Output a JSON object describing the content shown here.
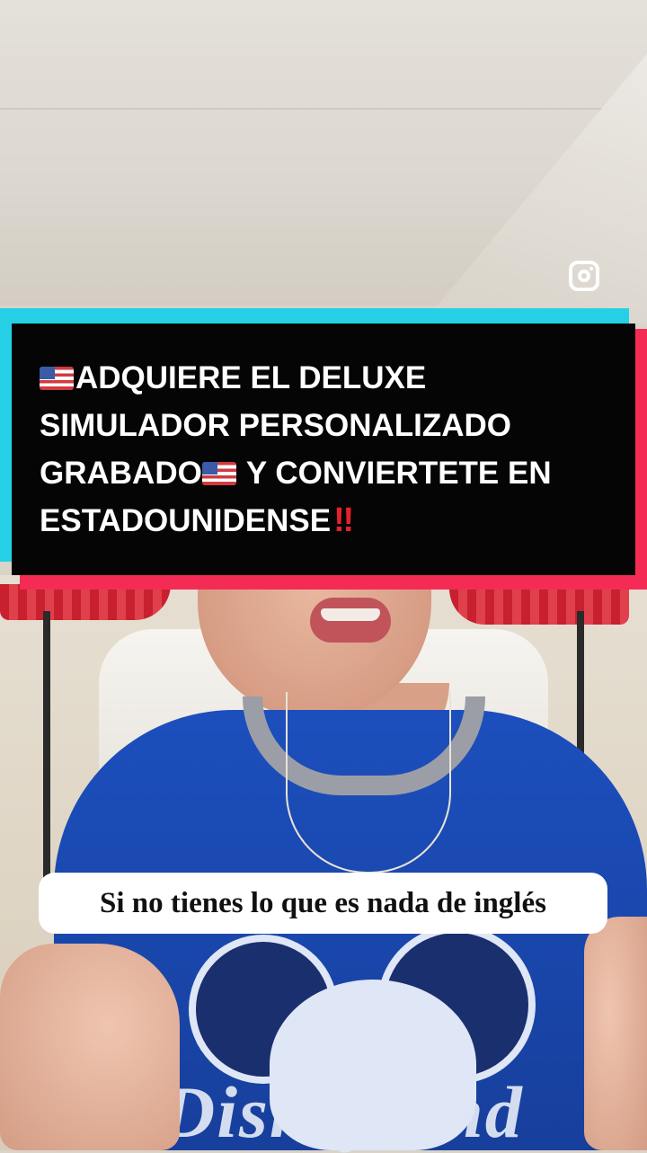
{
  "overlay": {
    "instagram_icon": "instagram-icon",
    "banner_lines": [
      "ADQUIERE EL DELUXE",
      "SIMULADOR PERSONALIZADO",
      "GRABADO",
      " Y CONVIERTETE EN",
      "ESTADOUNIDENSE"
    ],
    "banner_emoji_flag": "us-flag-icon",
    "banner_emoji_alert": "‼",
    "caption": "Si no tienes lo que es nada de inglés",
    "shirt_print": "Disneyland"
  },
  "colors": {
    "banner_bg": "#050505",
    "banner_shadow_cyan": "#25d0e6",
    "banner_shadow_red": "#f42c55",
    "caption_bg": "#ffffff",
    "shirt_blue": "#1c4fbd"
  }
}
